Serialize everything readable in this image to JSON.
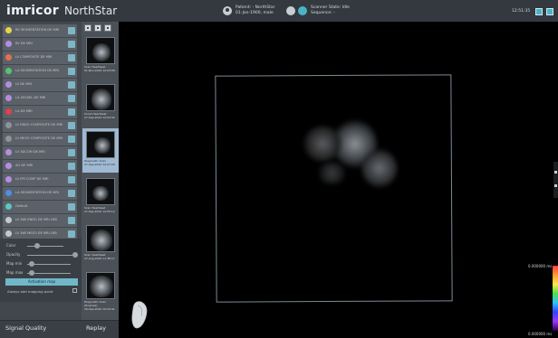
{
  "app": {
    "logo": "imricor",
    "product": "NorthStar"
  },
  "header": {
    "patient_line1": "Patient: - NorthStar",
    "patient_line2": "01-Jan-1900, male",
    "scanner_line1": "Scanner State: Idle",
    "scanner_line2": "Sequence: -",
    "clock": "12:51:35"
  },
  "map_items": [
    {
      "label": "RV SEGMENTATION DE MRI",
      "color": "#e8d34a"
    },
    {
      "label": "RV DE MRI",
      "color": "#b58de0"
    },
    {
      "label": "LV COMPOSITE DE MRI",
      "color": "#e46f4e"
    },
    {
      "label": "LA SEGMENTATION DE MRI",
      "color": "#56c46a"
    },
    {
      "label": "LV DE MRI",
      "color": "#b58de0"
    },
    {
      "label": "LA VESSEL DE MRI",
      "color": "#b58de0"
    },
    {
      "label": "LA DE MRI",
      "color": "#e0404f"
    },
    {
      "label": "LV ENDO COMPOSITE DE MRI",
      "color": "#8d9399"
    },
    {
      "label": "LV MESO COMPOSITE DE MRI",
      "color": "#8d9399"
    },
    {
      "label": "LV 3DCOM DE MRI",
      "color": "#b58de0"
    },
    {
      "label": "AO DE MRI",
      "color": "#b58de0"
    },
    {
      "label": "LV EPI COMP DE MRI",
      "color": "#b58de0"
    },
    {
      "label": "LA SEGMENTATION DE MRI",
      "color": "#4d8fe0"
    },
    {
      "label": "Default",
      "color": "#5cc7c0"
    },
    {
      "label": "LV 3Wl ENDO DE MRI LRB",
      "color": "#c4c9ce"
    },
    {
      "label": "LV 3Wl MESO DE MRI LRB",
      "color": "#c4c9ce"
    },
    {
      "label": "LV 3Wl EPI DE MRI LRB",
      "color": "#c4c9ce"
    }
  ],
  "controls": {
    "color_label": "Color",
    "opacity_label": "Opacity",
    "map_min_label": "Map min",
    "map_max_label": "Map max",
    "activation_button": "Activation map",
    "always_label": "Always add mapping point"
  },
  "panels": {
    "signal_quality": "Signal Quality",
    "replay": "Replay"
  },
  "series": [
    {
      "line1": "Scan Heartbeat",
      "line2": "01-Nov-2022 12:03:58",
      "selected": false
    },
    {
      "line1": "Scout Heartbeat",
      "line2": "27-Sep-2022 12:04:32",
      "selected": false
    },
    {
      "line1": "Diagnostic Scan",
      "line2": "27-Sep-2022 12:07:29",
      "selected": true
    },
    {
      "line1": "Scan Heartbeat",
      "line2": "27-Sep-2022 12:05:12",
      "selected": false
    },
    {
      "line1": "Scan Heartbeat",
      "line2": "27-Aug-2022 11:38:17",
      "selected": false
    },
    {
      "line1": "Diagnostic Scan (Purpose)",
      "line2": "26-Sep-2022 10:20:41",
      "selected": false
    }
  ],
  "colorbar": {
    "top_label": "0.000000 ms",
    "bottom_label": "0.000000 ms"
  },
  "icons": [
    "patient-icon",
    "scanner-icon",
    "status-icon",
    "layout-icon",
    "fullscreen-icon",
    "eye-icon",
    "orientation-heart-icon"
  ]
}
